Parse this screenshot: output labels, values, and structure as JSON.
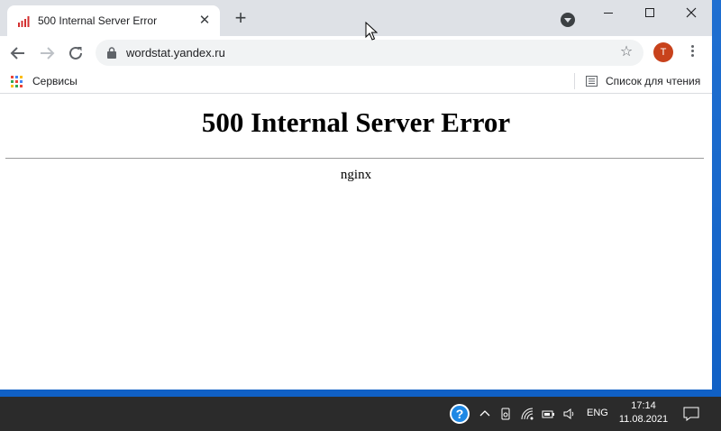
{
  "browser": {
    "tab": {
      "title": "500 Internal Server Error",
      "close_label": "✕"
    },
    "new_tab_label": "+",
    "address": {
      "url": "wordstat.yandex.ru"
    },
    "profile_initial": "T",
    "bookmarks": {
      "apps_label": "Сервисы",
      "reading_list_label": "Список для чтения"
    }
  },
  "page": {
    "heading": "500 Internal Server Error",
    "server": "nginx"
  },
  "taskbar": {
    "help_label": "?",
    "language": "ENG",
    "time": "17:14",
    "date": "11.08.2021"
  },
  "colors": {
    "tabstrip": "#dee1e6",
    "omnibox": "#f1f3f4",
    "avatar": "#c8421c",
    "taskbar": "#2b2b2b",
    "desktop": "#1565c0"
  }
}
